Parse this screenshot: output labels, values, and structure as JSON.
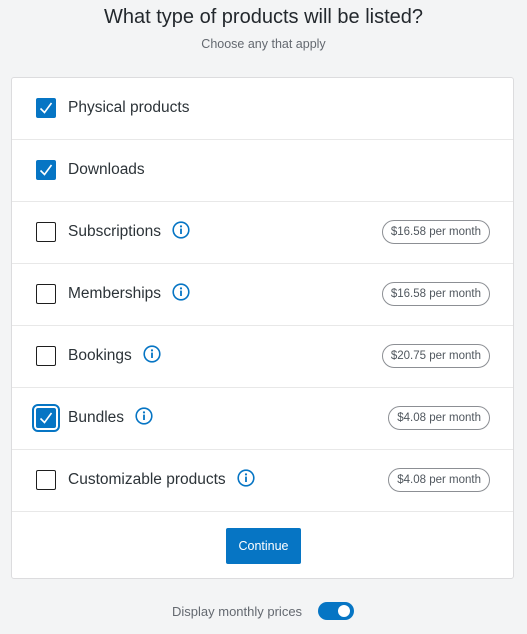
{
  "header": {
    "title": "What type of products will be listed?",
    "subtitle": "Choose any that apply"
  },
  "options": [
    {
      "label": "Physical products",
      "checked": true,
      "info": false,
      "price": ""
    },
    {
      "label": "Downloads",
      "checked": true,
      "info": false,
      "price": ""
    },
    {
      "label": "Subscriptions",
      "checked": false,
      "info": true,
      "price": "$16.58 per month"
    },
    {
      "label": "Memberships",
      "checked": false,
      "info": true,
      "price": "$16.58 per month"
    },
    {
      "label": "Bookings",
      "checked": false,
      "info": true,
      "price": "$20.75 per month"
    },
    {
      "label": "Bundles",
      "checked": true,
      "focused": true,
      "info": true,
      "price": "$4.08 per month"
    },
    {
      "label": "Customizable products",
      "checked": false,
      "info": true,
      "price": "$4.08 per month"
    }
  ],
  "continue_label": "Continue",
  "toggle": {
    "label": "Display monthly prices",
    "on": true
  },
  "colors": {
    "accent": "#0675c4"
  }
}
